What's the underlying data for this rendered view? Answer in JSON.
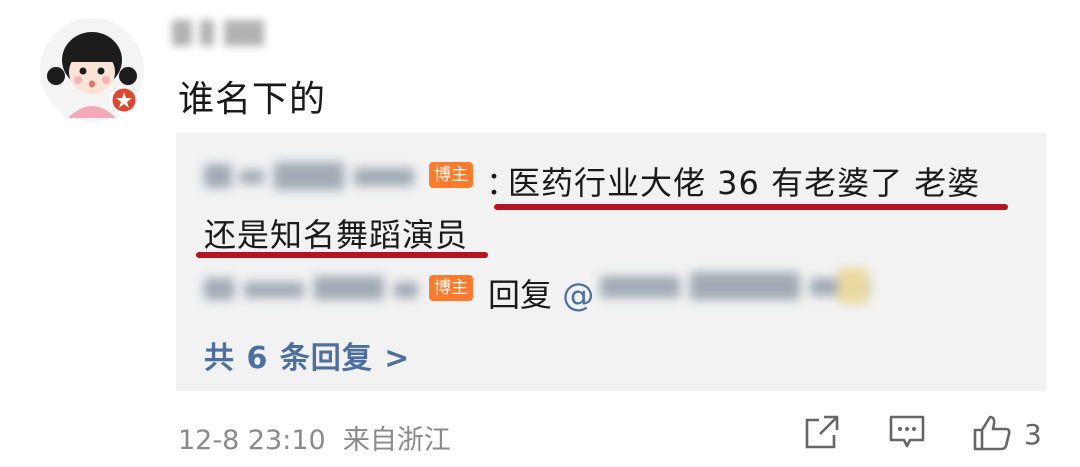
{
  "post": {
    "text": "谁名下的"
  },
  "reply": {
    "badge": "博主",
    "colon": "：",
    "line1": "医药行业大佬 36 有老婆了 老婆",
    "line2": "还是知名舞蹈演员"
  },
  "reply2": {
    "badge": "博主",
    "reply_label": "回复",
    "at_sign": "@"
  },
  "more_replies": "共 6 条回复 >",
  "meta": {
    "time": "12-8 23:10",
    "source": "来自浙江"
  },
  "actions": {
    "share_icon": "share-icon",
    "comment_icon": "comment-icon",
    "like_icon": "thumbs-up-icon",
    "like_count": "3"
  },
  "colors": {
    "badge": "#ff7a2c",
    "underline": "#b3141f",
    "link": "#4a6fa0",
    "reply_bg": "#f2f2f2"
  }
}
